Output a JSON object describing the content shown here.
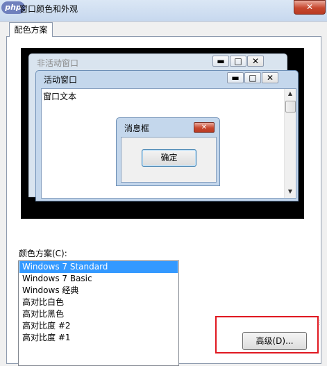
{
  "window": {
    "title": "窗口颜色和外观",
    "logo_text": "php",
    "close_glyph": "✕"
  },
  "tabs": [
    {
      "label": "配色方案",
      "active": true
    }
  ],
  "preview": {
    "inactive_window_title": "非活动窗口",
    "active_window_title": "活动窗口",
    "window_text": "窗口文本",
    "message_box_title": "消息框",
    "ok_label": "确定",
    "min_glyph": "▬",
    "max_glyph": "□",
    "close_glyph": "✕",
    "scroll_up_glyph": "▲",
    "scroll_down_glyph": "▼"
  },
  "scheme": {
    "label": "颜色方案(C):",
    "items": [
      {
        "label": "Windows 7 Standard",
        "selected": true
      },
      {
        "label": "Windows 7 Basic",
        "selected": false
      },
      {
        "label": "Windows 经典",
        "selected": false
      },
      {
        "label": "高对比白色",
        "selected": false
      },
      {
        "label": "高对比黑色",
        "selected": false
      },
      {
        "label": "高对比度 #2",
        "selected": false
      },
      {
        "label": "高对比度 #1",
        "selected": false
      }
    ]
  },
  "advanced_button": {
    "label": "高级(D)..."
  },
  "colors": {
    "selection": "#3399ff",
    "highlight_box": "#e01820",
    "title_close": "#c8482f"
  }
}
